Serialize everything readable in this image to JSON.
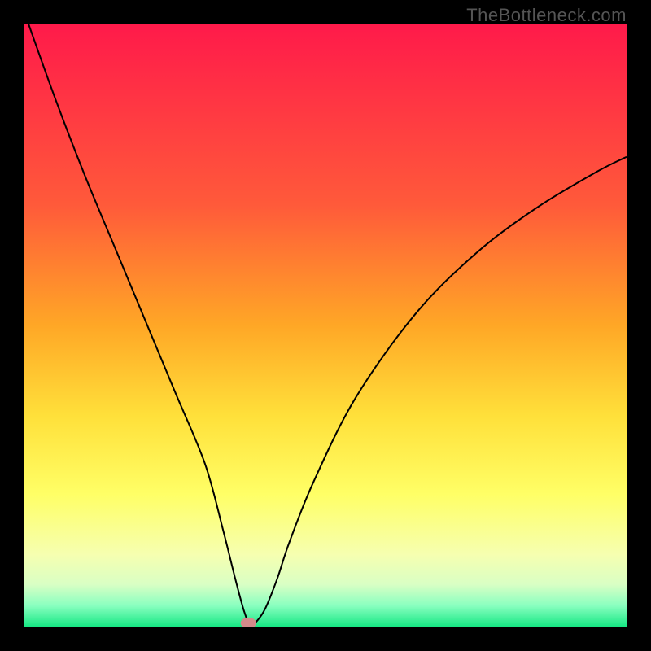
{
  "watermark": "TheBottleneck.com",
  "chart_data": {
    "type": "line",
    "title": "",
    "xlabel": "",
    "ylabel": "",
    "xlim": [
      0,
      100
    ],
    "ylim": [
      0,
      100
    ],
    "background_gradient": {
      "stops": [
        {
          "offset": 0.0,
          "color": "#ff1a4a"
        },
        {
          "offset": 0.3,
          "color": "#ff5a3a"
        },
        {
          "offset": 0.5,
          "color": "#ffa726"
        },
        {
          "offset": 0.65,
          "color": "#ffe03a"
        },
        {
          "offset": 0.78,
          "color": "#ffff66"
        },
        {
          "offset": 0.88,
          "color": "#f6ffb0"
        },
        {
          "offset": 0.93,
          "color": "#d9ffc4"
        },
        {
          "offset": 0.965,
          "color": "#8affc0"
        },
        {
          "offset": 1.0,
          "color": "#17e884"
        }
      ]
    },
    "series": [
      {
        "name": "bottleneck-curve",
        "stroke": "#000000",
        "stroke_width": 2,
        "x": [
          0,
          5,
          10,
          15,
          20,
          25,
          30,
          33,
          35,
          36.5,
          37.5,
          38.5,
          40,
          42,
          44,
          48,
          55,
          65,
          75,
          85,
          95,
          100
        ],
        "values": [
          102,
          88,
          75,
          63,
          51,
          39,
          27,
          16,
          8,
          2.5,
          0.3,
          0.8,
          3,
          8,
          14,
          24,
          38,
          52,
          62,
          69.5,
          75.5,
          78
        ]
      }
    ],
    "marker": {
      "name": "optimal-point",
      "x": 37.2,
      "value": 0.6,
      "rx": 1.3,
      "ry": 0.9,
      "fill": "#d38a8a"
    }
  }
}
